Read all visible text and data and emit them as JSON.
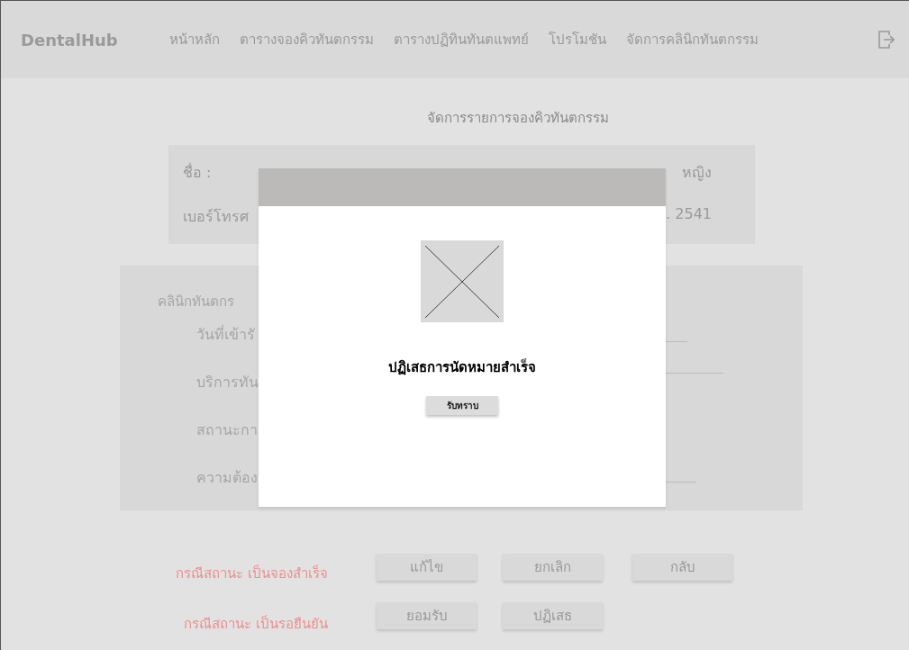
{
  "nav": {
    "brand": "DentalHub",
    "items": [
      "หน้าหลัก",
      "ตารางจองคิวทันตกรรม",
      "ตารางปฏิทินทันตแพทย์",
      "โปรโมชัน",
      "จัดการคลินิกทันตกรรม"
    ]
  },
  "page_title": "จัดการรายการจองคิวทันตกรรม",
  "patient_card": {
    "rows": [
      {
        "label": "ชื่อ :",
        "value": "หญิง"
      },
      {
        "label": "เบอร์โทรศ",
        "value": ". 2541"
      }
    ]
  },
  "clinic_card": {
    "heading": "คลินิกทันตกร",
    "labels": [
      "วันที่เข้ารั",
      "บริการทัน",
      "สถานะกา",
      "ความต้อง"
    ]
  },
  "actions": [
    {
      "label": "กรณีสถานะ เป็นจองสำเร็จ",
      "buttons": [
        "แก้ไข",
        "ยกเลิก",
        "กลับ"
      ]
    },
    {
      "label": "กรณีสถานะ เป็นรอยืนยัน",
      "buttons": [
        "ยอมรับ",
        "ปฏิเสธ"
      ]
    }
  ],
  "dialog": {
    "message": "ปฏิเสธการนัดหมายสำเร็จ",
    "button": "รับทราบ"
  }
}
